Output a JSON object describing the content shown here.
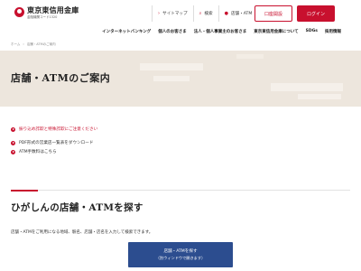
{
  "header": {
    "logo_name": "東京東信用金庫",
    "logo_code": "金融機関コード1320",
    "util_nav": [
      {
        "label": "サイトマップ",
        "icon": "chevron-right-icon"
      },
      {
        "label": "検索",
        "icon": "search-icon"
      },
      {
        "label": "店舗・ATM",
        "icon": "location-pin-icon"
      }
    ],
    "open_account_label": "口座開設",
    "login_label": "ログイン",
    "brand_color": "#c8102e"
  },
  "main_nav": [
    "インターネットバンキング",
    "個人のお客さま",
    "法人・個人事業主のお客さま",
    "東京東信用金庫について",
    "SDGs",
    "採用情報"
  ],
  "breadcrumb": [
    "ホーム",
    "店舗・ATMのご案内"
  ],
  "hero": {
    "title": "店舗・ATMのご案内",
    "background_color": "#ede6dd"
  },
  "notices": {
    "warning": "振り込め詐欺と特殊詐欺にご注意ください",
    "links": [
      "PDF形式の営業店一覧表をダウンロード",
      "ATM手数料はこちら"
    ]
  },
  "section": {
    "title": "ひがしんの店舗・ATMを探す",
    "description": "店舗・ATMをご利用になる地域、駅名、店舗・店名を入力して検索できます。",
    "search_button": {
      "label": "店舗・ATMを探す",
      "sublabel": "（別ウィンドウで開きます）",
      "color": "#2c4d8f"
    }
  }
}
